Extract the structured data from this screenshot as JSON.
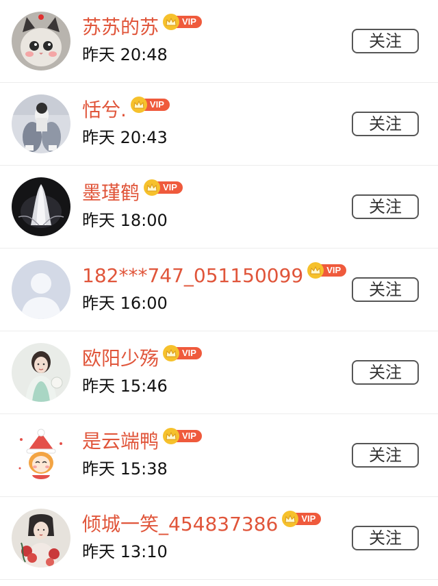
{
  "follow_label": "关注",
  "vip_label": "VIP",
  "colors": {
    "name": "#e0553a",
    "vip_badge": "#ef5a3c",
    "crown": "#f6c12c"
  },
  "users": [
    {
      "name": "苏苏的苏",
      "time": "昨天 20:48",
      "vip": true,
      "avatar": "cat-avatar"
    },
    {
      "name": "恬兮.",
      "time": "昨天 20:43",
      "vip": true,
      "avatar": "pet-photo-avatar"
    },
    {
      "name": "墨瑾鹤",
      "time": "昨天 18:00",
      "vip": true,
      "avatar": "dark-figure-avatar"
    },
    {
      "name": "182***747_051150099",
      "time": "昨天 16:00",
      "vip": true,
      "avatar": "default-avatar"
    },
    {
      "name": "欧阳少殇",
      "time": "昨天 15:46",
      "vip": true,
      "avatar": "hanfu-girl-avatar"
    },
    {
      "name": "是云端鸭",
      "time": "昨天 15:38",
      "vip": true,
      "avatar": "cartoon-girl-avatar"
    },
    {
      "name": "倾城一笑_454837386",
      "time": "昨天 13:10",
      "vip": true,
      "avatar": "floral-portrait-avatar"
    }
  ]
}
